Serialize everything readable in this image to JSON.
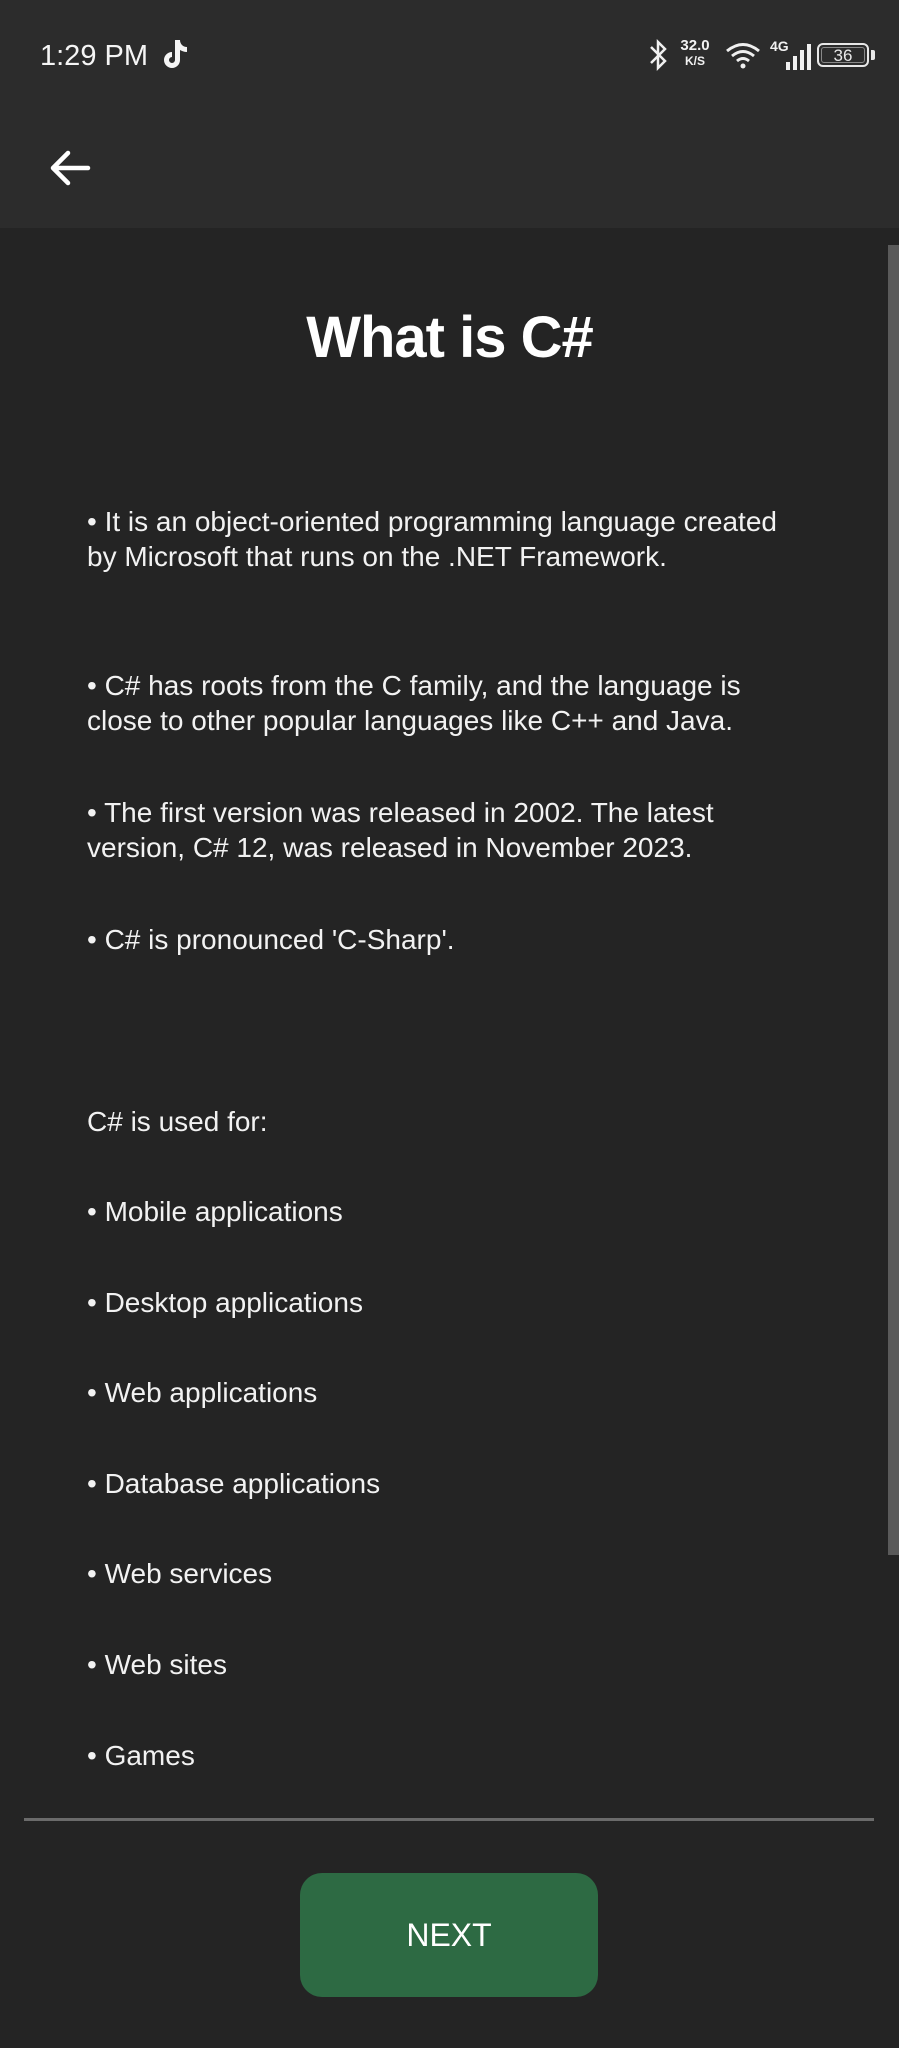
{
  "status_bar": {
    "time": "1:29 PM",
    "network_speed_value": "32.0",
    "network_speed_unit": "K/S",
    "network_type": "4G",
    "battery_level": "36"
  },
  "app_bar": {
    "back_icon": "arrow-left-icon"
  },
  "page": {
    "title": "What is C#",
    "paragraphs": [
      "• It is an object-oriented programming language created by Microsoft that runs on the .NET Framework.",
      "• C# has roots from the C family, and the language is close to other popular languages like C++ and Java.",
      "• The first version was released in 2002. The latest version, C# 12, was released in November 2023.",
      "• C# is pronounced 'C-Sharp'."
    ],
    "used_for_heading": "C# is used for:",
    "used_for_items": [
      "• Mobile applications",
      "• Desktop applications",
      "• Web applications",
      "• Database applications",
      "• Web services",
      "• Web sites",
      "• Games"
    ]
  },
  "footer": {
    "next_label": "NEXT"
  },
  "colors": {
    "background": "#242424",
    "bar": "#2c2c2c",
    "button": "#2d6a43",
    "text": "#f2f2f2"
  }
}
